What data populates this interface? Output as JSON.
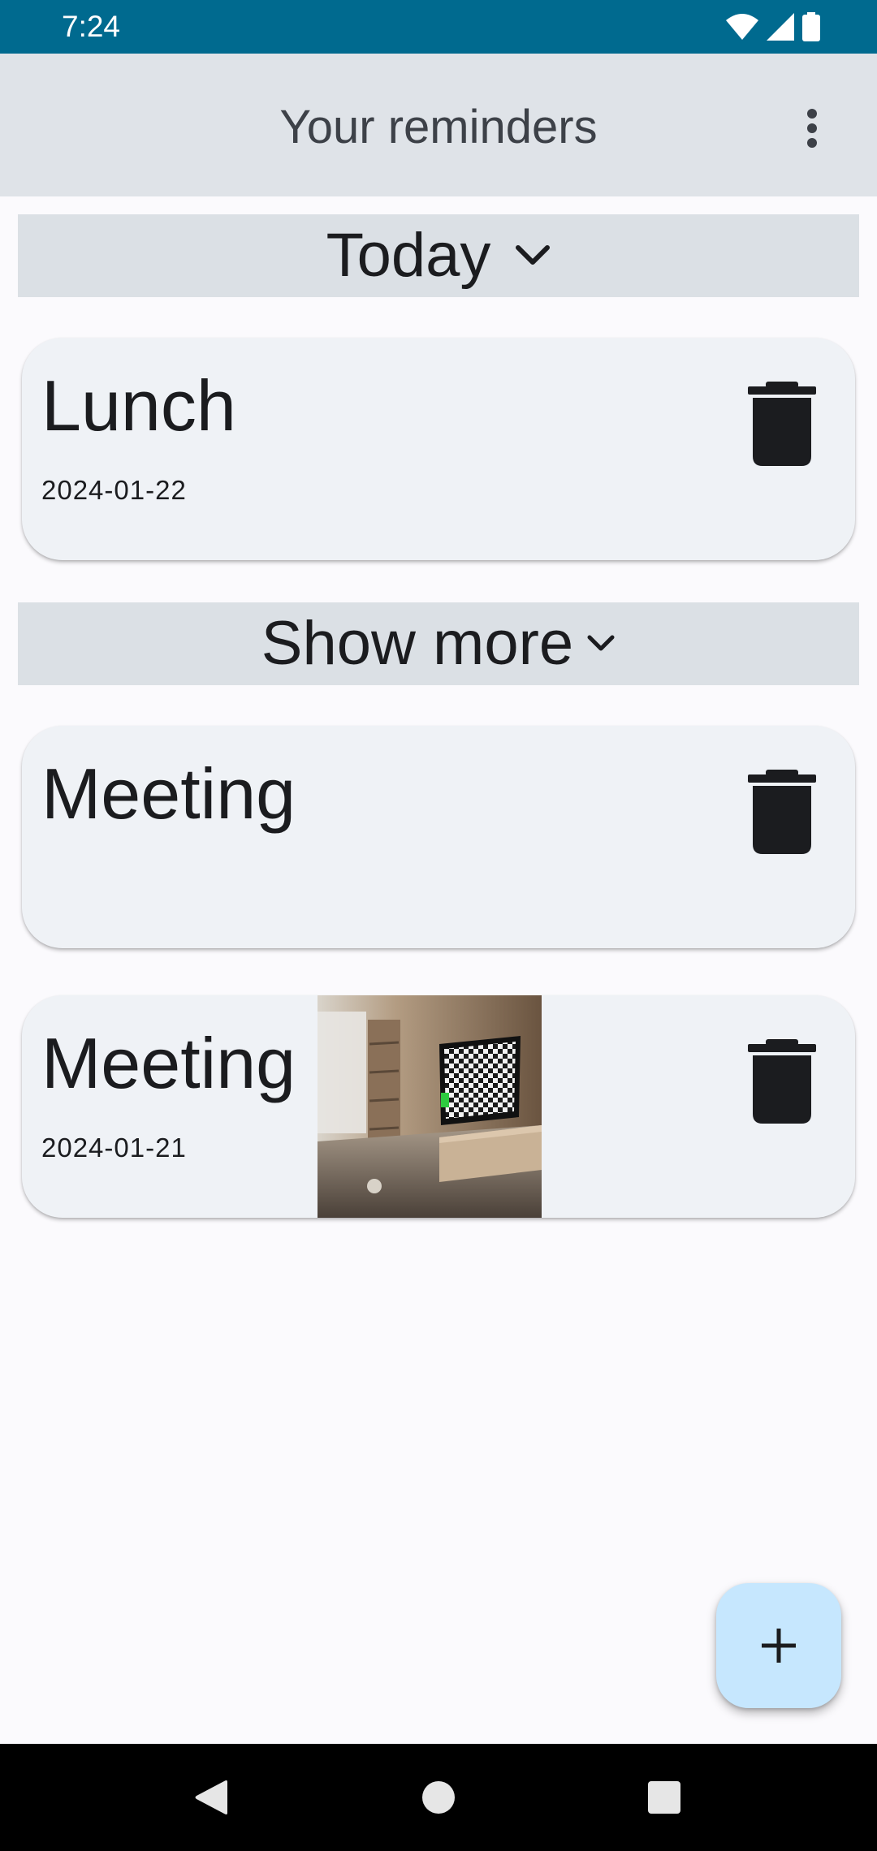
{
  "status_bar": {
    "time": "7:24",
    "icons": [
      "wifi-icon",
      "signal-icon",
      "battery-icon"
    ]
  },
  "app_bar": {
    "title": "Your reminders",
    "menu_icon": "more-vert-icon"
  },
  "sections": {
    "today": {
      "label": "Today",
      "icon": "chevron-down-icon"
    },
    "show_more": {
      "label": "Show more",
      "icon": "chevron-down-icon"
    }
  },
  "reminders": [
    {
      "title": "Lunch",
      "date": "2024-01-22",
      "has_image": false
    },
    {
      "title": "Meeting",
      "date": "",
      "has_image": false
    },
    {
      "title": "Meeting",
      "date": "2024-01-21",
      "has_image": true,
      "image": "living-room-tv-thumbnail"
    }
  ],
  "fab": {
    "icon": "plus-icon"
  },
  "nav_bar": {
    "icons": [
      "back-icon",
      "home-icon",
      "recents-icon"
    ]
  },
  "colors": {
    "status_bar": "#006a8f",
    "app_bar": "#dfe3e8",
    "section_header": "#dbe0e5",
    "card": "#eff2f6",
    "fab": "#c6e7fe",
    "background": "#fbfafd"
  }
}
